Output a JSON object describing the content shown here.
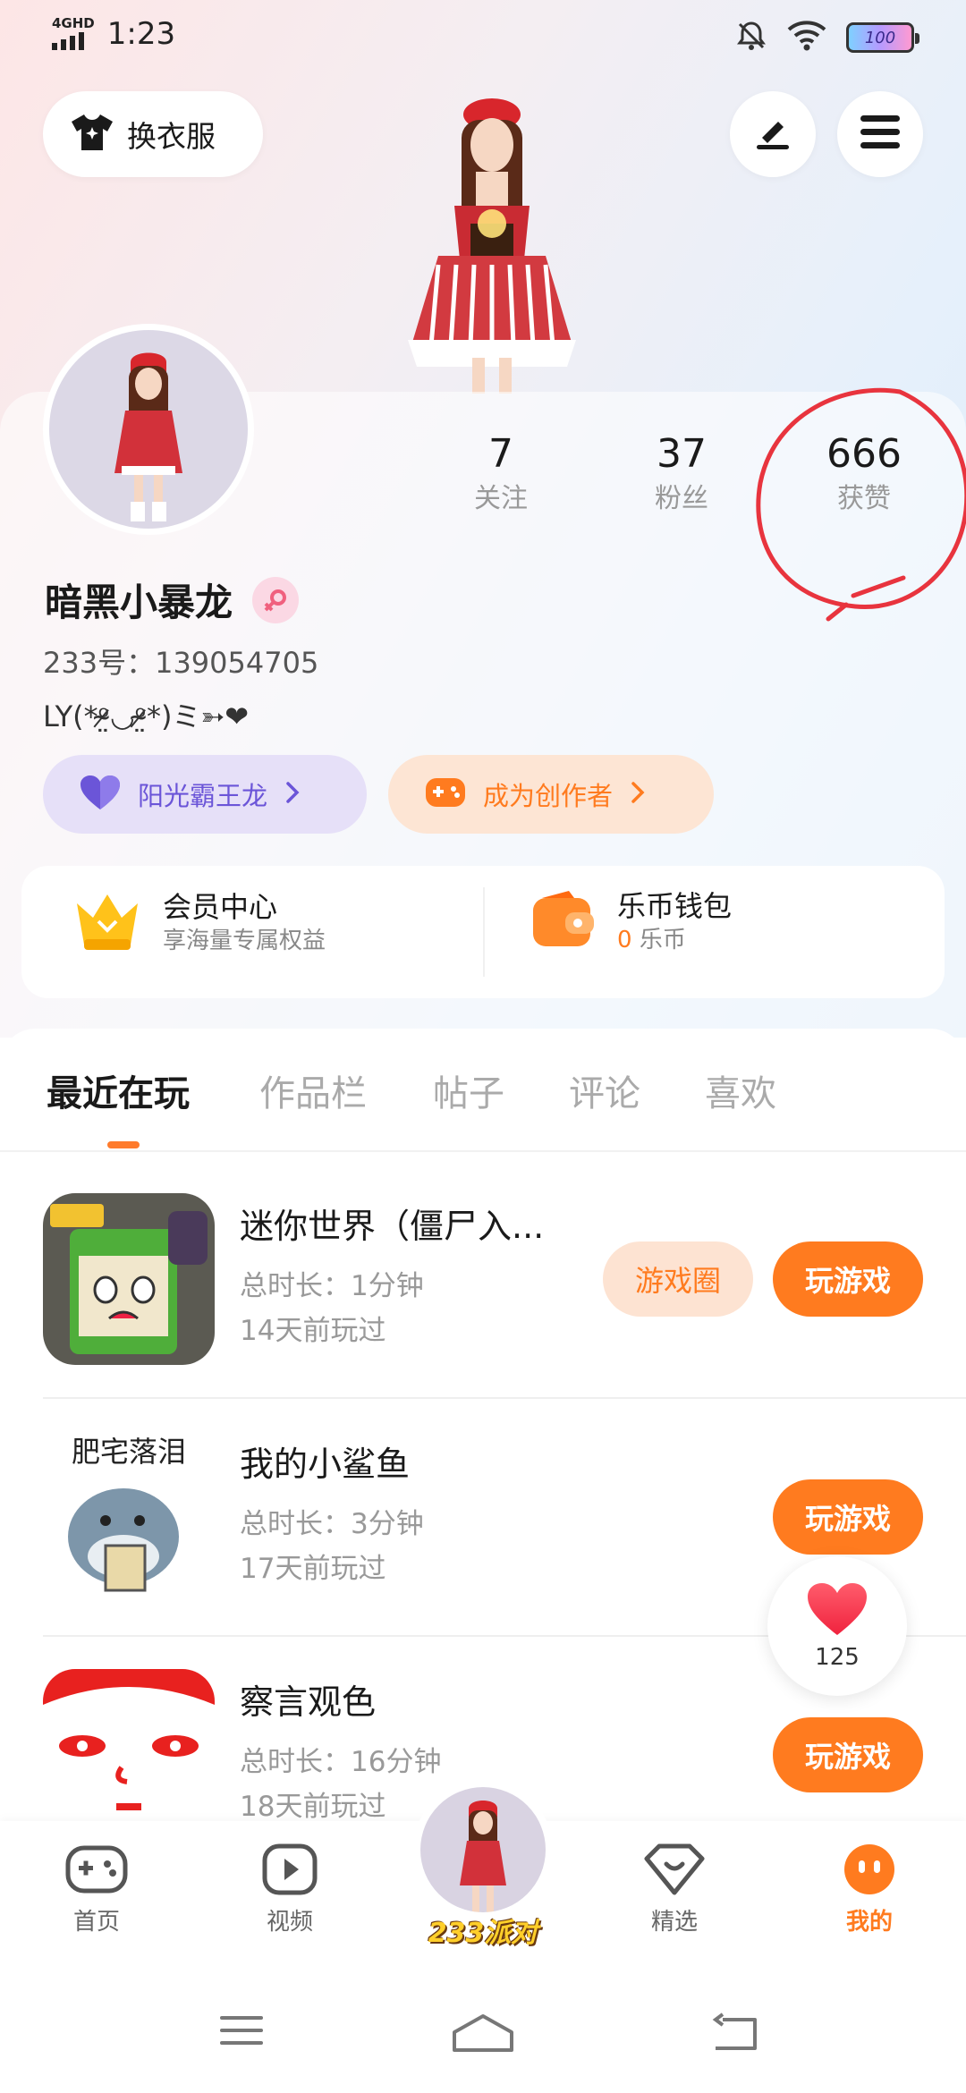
{
  "status_bar": {
    "network": "4GHD",
    "time": "1:23",
    "battery": "100"
  },
  "header": {
    "outfit_button": "换衣服"
  },
  "profile": {
    "stats": [
      {
        "value": "7",
        "label": "关注"
      },
      {
        "value": "37",
        "label": "粉丝"
      },
      {
        "value": "666",
        "label": "获赞"
      }
    ],
    "name": "暗黑小暴龙",
    "uid": "233号：139054705",
    "signature": "LY(*ᵒ̴̷̤◡ᵒ̴̷̤*)ミ➳❤",
    "badges": {
      "level": "阳光霸王龙",
      "creator": "成为创作者"
    }
  },
  "wallet": {
    "vip": {
      "title": "会员中心",
      "subtitle": "享海量专属权益"
    },
    "coins": {
      "title": "乐币钱包",
      "amount": "0",
      "unit": "乐币"
    }
  },
  "tabs": [
    "最近在玩",
    "作品栏",
    "帖子",
    "评论",
    "喜欢"
  ],
  "games": [
    {
      "title": "迷你世界（僵尸入...",
      "duration": "总时长：1分钟",
      "last_played": "14天前玩过",
      "circle_button": "游戏圈",
      "play_button": "玩游戏"
    },
    {
      "title": "我的小鲨鱼",
      "duration": "总时长：3分钟",
      "last_played": "17天前玩过",
      "icon_text": "肥宅落泪",
      "play_button": "玩游戏"
    },
    {
      "title": "察言观色",
      "duration": "总时长：16分钟",
      "last_played": "18天前玩过",
      "play_button": "玩游戏"
    }
  ],
  "like_bubble": {
    "count": "125"
  },
  "bottom_nav": {
    "items": [
      {
        "label": "首页"
      },
      {
        "label": "视频"
      },
      {
        "label": "233派对"
      },
      {
        "label": "精选"
      },
      {
        "label": "我的"
      }
    ]
  },
  "colors": {
    "accent": "#ff7b1f",
    "purple": "#6b55d8"
  }
}
